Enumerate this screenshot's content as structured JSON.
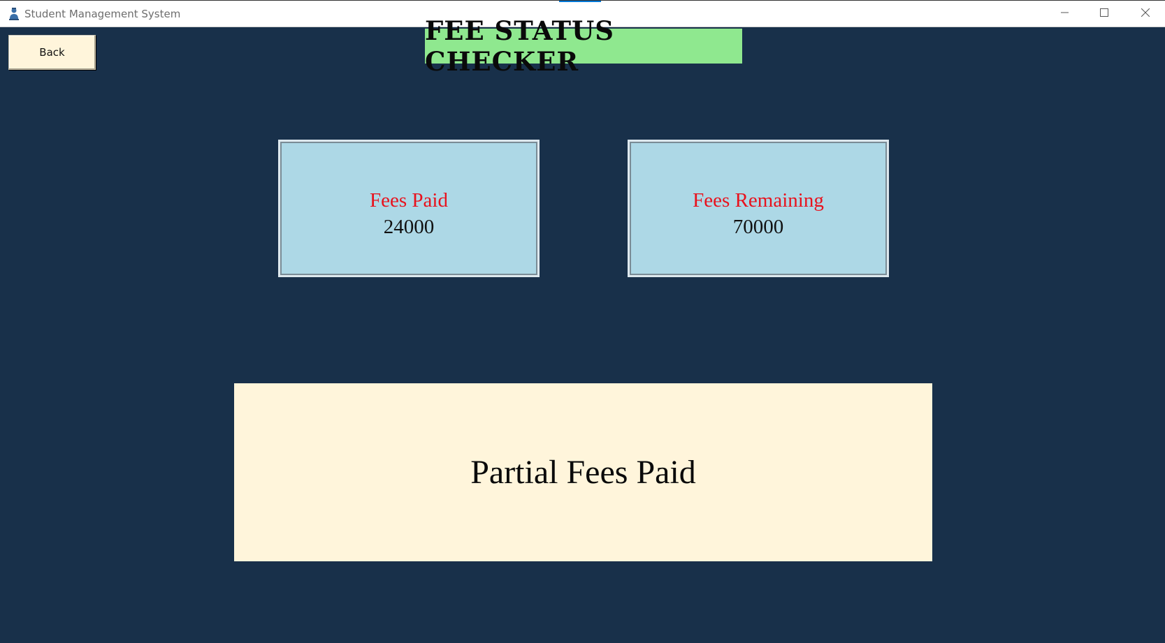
{
  "window": {
    "title": "Student Management System",
    "icon": "student-user-icon",
    "controls": [
      "minimize-icon",
      "maximize-icon",
      "close-icon"
    ]
  },
  "toolbar": {
    "back_label": "Back"
  },
  "heading": {
    "text": "FEE STATUS CHECKER"
  },
  "cards": {
    "paid": {
      "label": "Fees Paid",
      "value": "24000"
    },
    "remaining": {
      "label": "Fees Remaining",
      "value": "70000"
    }
  },
  "status": {
    "text": "Partial Fees Paid"
  },
  "colors": {
    "background": "#18304a",
    "heading_bg": "#8fe88f",
    "card_bg": "#add8e6",
    "label_red": "#e8121d",
    "status_bg": "#fff5db"
  }
}
